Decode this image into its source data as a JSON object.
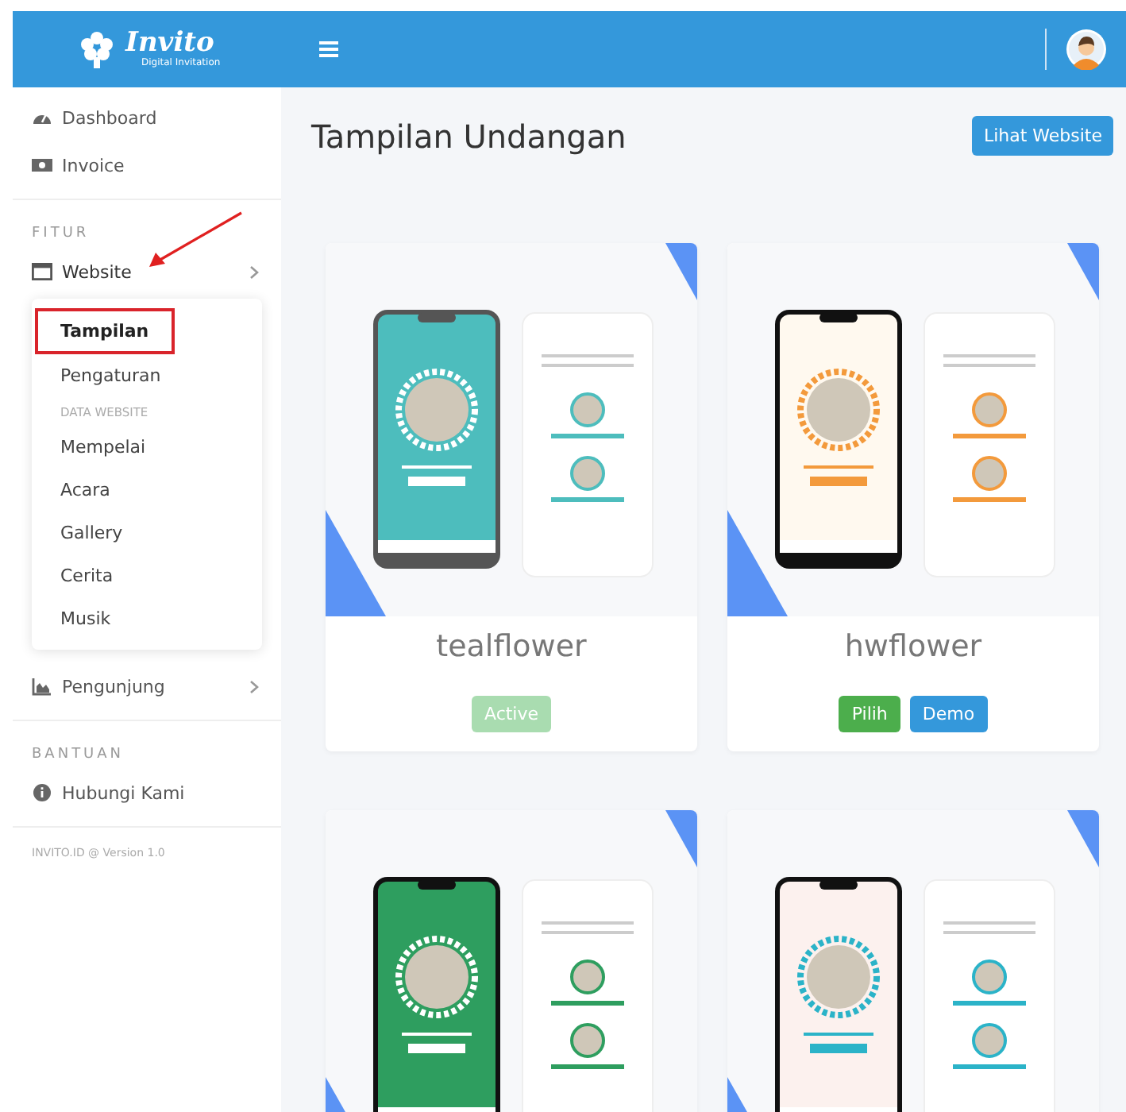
{
  "header": {
    "logo_name": "Invito",
    "logo_tagline": "Digital Invitation"
  },
  "sidebar": {
    "sections": [
      {
        "items": [
          {
            "label": "Dashboard",
            "expandable": false
          },
          {
            "label": "Invoice",
            "expandable": false
          }
        ]
      },
      {
        "heading": "FITUR",
        "items": [
          {
            "label": "Website",
            "expandable": true,
            "expanded": true,
            "submenu": [
              {
                "kind": "link",
                "label": "Tampilan",
                "selected": true
              },
              {
                "kind": "link",
                "label": "Pengaturan",
                "selected": false
              },
              {
                "kind": "heading",
                "label": "DATA WEBSITE"
              },
              {
                "kind": "link",
                "label": "Mempelai",
                "selected": false
              },
              {
                "kind": "link",
                "label": "Acara",
                "selected": false
              },
              {
                "kind": "link",
                "label": "Gallery",
                "selected": false
              },
              {
                "kind": "link",
                "label": "Cerita",
                "selected": false
              },
              {
                "kind": "link",
                "label": "Musik",
                "selected": false
              }
            ]
          },
          {
            "label": "Pengunjung",
            "expandable": true,
            "expanded": false
          }
        ]
      },
      {
        "heading": "BANTUAN",
        "items": [
          {
            "label": "Hubungi Kami",
            "expandable": false
          }
        ]
      }
    ],
    "footer": "INVITO.ID @ Version 1.0"
  },
  "page_title": "Tampilan Undangan",
  "view_website_button": "Lihat Website",
  "themes": [
    {
      "kind": "full",
      "name": "tealflower",
      "buttons": [
        {
          "kind": "active",
          "label": "Active"
        }
      ]
    },
    {
      "kind": "full",
      "name": "hwflower",
      "buttons": [
        {
          "kind": "choose",
          "label": "Pilih"
        },
        {
          "kind": "demo",
          "label": "Demo"
        }
      ]
    },
    {
      "kind": "preview"
    },
    {
      "kind": "preview"
    }
  ]
}
